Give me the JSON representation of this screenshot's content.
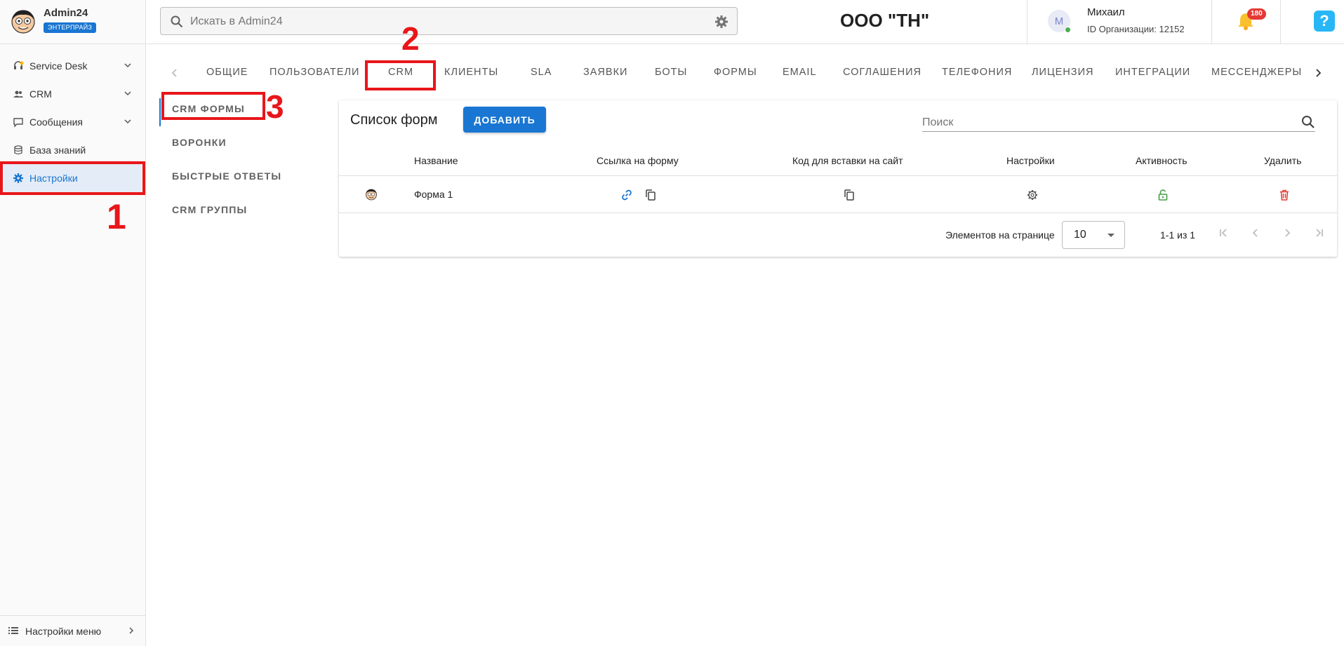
{
  "app": {
    "name": "Admin24",
    "plan_badge": "ЭНТЕРПРАЙЗ"
  },
  "sidebar": {
    "items": [
      {
        "label": "Service Desk",
        "icon": "headset-icon",
        "expandable": true
      },
      {
        "label": "CRM",
        "icon": "users-icon",
        "expandable": true
      },
      {
        "label": "Сообщения",
        "icon": "chat-icon",
        "expandable": true
      },
      {
        "label": "База знаний",
        "icon": "database-icon",
        "expandable": false
      },
      {
        "label": "Настройки",
        "icon": "gear-icon",
        "expandable": false,
        "active": true
      }
    ],
    "footer_label": "Настройки меню"
  },
  "topbar": {
    "search_placeholder": "Искать в Admin24",
    "org_title": "ООО \"ТН\"",
    "user_initial": "М",
    "user_name": "Михаил",
    "org_id": "ID Организации: 12152",
    "notifications_count": "180",
    "help_label": "?"
  },
  "tabs": [
    "ОБЩИЕ",
    "ПОЛЬЗОВАТЕЛИ",
    "CRM",
    "КЛИЕНТЫ",
    "SLA",
    "ЗАЯВКИ",
    "БОТЫ",
    "ФОРМЫ",
    "EMAIL",
    "СОГЛАШЕНИЯ",
    "ТЕЛЕФОНИЯ",
    "ЛИЦЕНЗИЯ",
    "ИНТЕГРАЦИИ",
    "МЕССЕНДЖЕРЫ"
  ],
  "submenu": [
    "CRM ФОРМЫ",
    "ВОРОНКИ",
    "БЫСТРЫЕ ОТВЕТЫ",
    "CRM ГРУППЫ"
  ],
  "forms_card": {
    "title": "Список форм",
    "add_button": "ДОБАВИТЬ",
    "search_placeholder": "Поиск",
    "columns": [
      "Название",
      "Ссылка на форму",
      "Код для вставки на сайт",
      "Настройки",
      "Активность",
      "Удалить"
    ],
    "rows": [
      {
        "name": "Форма 1"
      }
    ],
    "pagination": {
      "per_page_label": "Элементов на странице",
      "per_page_value": "10",
      "range": "1-1 из 1"
    }
  },
  "annotations": [
    "1",
    "2",
    "3"
  ],
  "colors": {
    "primary": "#1976d2",
    "annotation_red": "#e8161a",
    "active_green": "#43a047",
    "delete_red": "#e53935"
  }
}
